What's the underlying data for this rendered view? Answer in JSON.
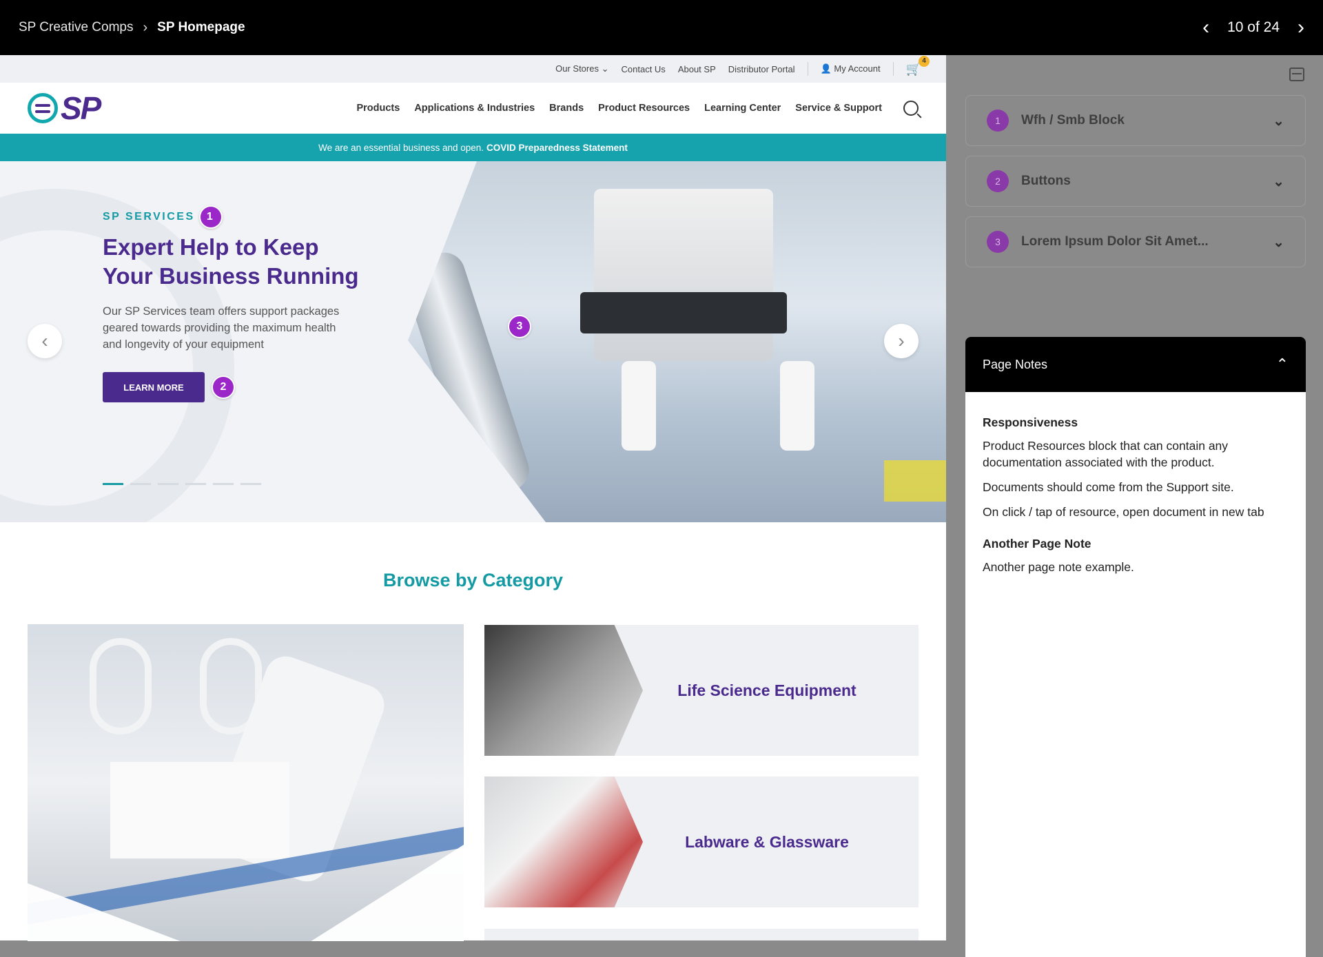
{
  "topbar": {
    "breadcrumb_parent": "SP Creative Comps",
    "breadcrumb_separator": "›",
    "breadcrumb_current": "SP Homepage",
    "pager_text": "10 of 24",
    "prev_icon": "chevron-left-icon",
    "next_icon": "chevron-right-icon"
  },
  "utility_nav": {
    "our_stores": "Our Stores",
    "contact_us": "Contact Us",
    "about_sp": "About SP",
    "distributor_portal": "Distributor Portal",
    "my_account": "My Account",
    "cart_count": "4"
  },
  "main_nav": {
    "logo_text": "SP",
    "items": [
      "Products",
      "Applications & Industries",
      "Brands",
      "Product Resources",
      "Learning Center",
      "Service & Support"
    ]
  },
  "covid_banner": {
    "text": "We are an essential business and open.",
    "link": "COVID Preparedness Statement"
  },
  "hero": {
    "eyebrow": "SP SERVICES",
    "title_line1": "Expert Help to Keep",
    "title_line2": "Your Business Running",
    "body": "Our SP Services team offers support packages geared towards providing the maximum health and longevity of your equipment",
    "cta_label": "LEARN MORE",
    "slide_count": 6,
    "active_slide": 1,
    "pins": [
      "1",
      "2",
      "3"
    ]
  },
  "browse": {
    "title": "Browse by Category",
    "categories": [
      "Life Science Equipment",
      "Labware & Glassware"
    ]
  },
  "panel": {
    "accordion": [
      {
        "num": "1",
        "label": "Wfh / Smb Block"
      },
      {
        "num": "2",
        "label": "Buttons"
      },
      {
        "num": "3",
        "label": "Lorem Ipsum Dolor Sit Amet..."
      }
    ],
    "notes_title": "Page Notes",
    "notes": {
      "heading1": "Responsiveness",
      "p1": "Product Resources block that can contain any documentation associated with the product.",
      "p2": "Documents should come from the Support site.",
      "p3": "On click / tap of resource, open document in new tab",
      "heading2": "Another Page Note",
      "p4": "Another page note example."
    }
  },
  "colors": {
    "brand_purple": "#4b2a8e",
    "brand_teal": "#16a3ad",
    "pin_purple": "#9b27c8",
    "cart_badge": "#f5b52a"
  }
}
